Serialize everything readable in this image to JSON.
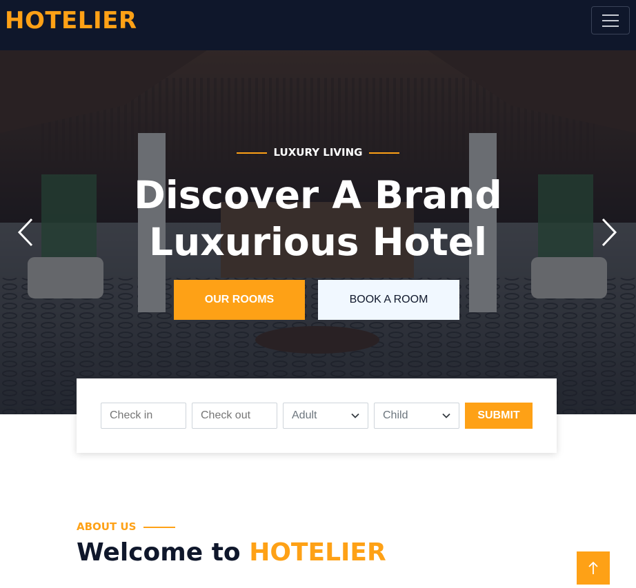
{
  "navbar": {
    "brand": "HOTELIER",
    "menu_icon": "hamburger-menu-icon"
  },
  "hero": {
    "eyebrow": "LUXURY LIVING",
    "title_line1": "Discover A Brand",
    "title_line2": "Luxurious Hotel",
    "primary_button": "OUR ROOMS",
    "secondary_button": "BOOK A ROOM",
    "prev_icon": "chevron-left-icon",
    "next_icon": "chevron-right-icon"
  },
  "booking": {
    "checkin_placeholder": "Check in",
    "checkout_placeholder": "Check out",
    "adult_selected": "Adult",
    "child_selected": "Child",
    "submit_label": "SUBMIT"
  },
  "about": {
    "label": "ABOUT US",
    "welcome_prefix": "Welcome to ",
    "welcome_brand": "HOTELIER"
  },
  "back_to_top": {
    "icon": "arrow-up-icon"
  },
  "colors": {
    "primary": "#fea116",
    "dark": "#0f172b",
    "light": "#f1f8ff"
  }
}
